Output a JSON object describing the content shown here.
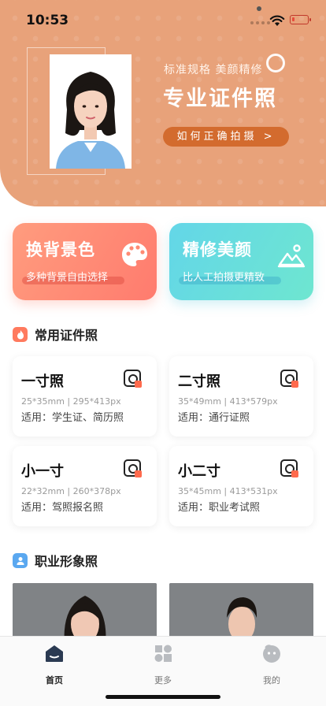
{
  "status_bar": {
    "time": "10:53"
  },
  "hero": {
    "subtitle": "标准规格 美颜精修",
    "title": "专业证件照",
    "cta_label": "如何正确拍摄 >"
  },
  "features": [
    {
      "title": "换背景色",
      "desc": "多种背景自由选择",
      "icon": "palette-icon"
    },
    {
      "title": "精修美颜",
      "desc": "比人工拍摄更精致",
      "icon": "image-icon"
    }
  ],
  "sections": {
    "common": {
      "title": "常用证件照",
      "icon": "flame-icon"
    },
    "career": {
      "title": "职业形象照",
      "icon": "person-badge-icon"
    }
  },
  "photo_types": [
    {
      "name": "一寸照",
      "spec": "25*35mm | 295*413px",
      "usage": "适用：学生证、简历照"
    },
    {
      "name": "二寸照",
      "spec": "35*49mm | 413*579px",
      "usage": "适用：通行证照"
    },
    {
      "name": "小一寸",
      "spec": "22*32mm | 260*378px",
      "usage": "适用：驾照报名照"
    },
    {
      "name": "小二寸",
      "spec": "35*45mm | 413*531px",
      "usage": "适用：职业考试照"
    }
  ],
  "tabs": [
    {
      "label": "首页",
      "icon": "home-icon",
      "active": true
    },
    {
      "label": "更多",
      "icon": "grid-icon",
      "active": false
    },
    {
      "label": "我的",
      "icon": "profile-icon",
      "active": false
    }
  ],
  "colors": {
    "hero_bg": "#e8a27a",
    "hero_button": "#d36b2e",
    "accent_orange": "#ff7b6e",
    "accent_teal": "#63d6e8"
  }
}
